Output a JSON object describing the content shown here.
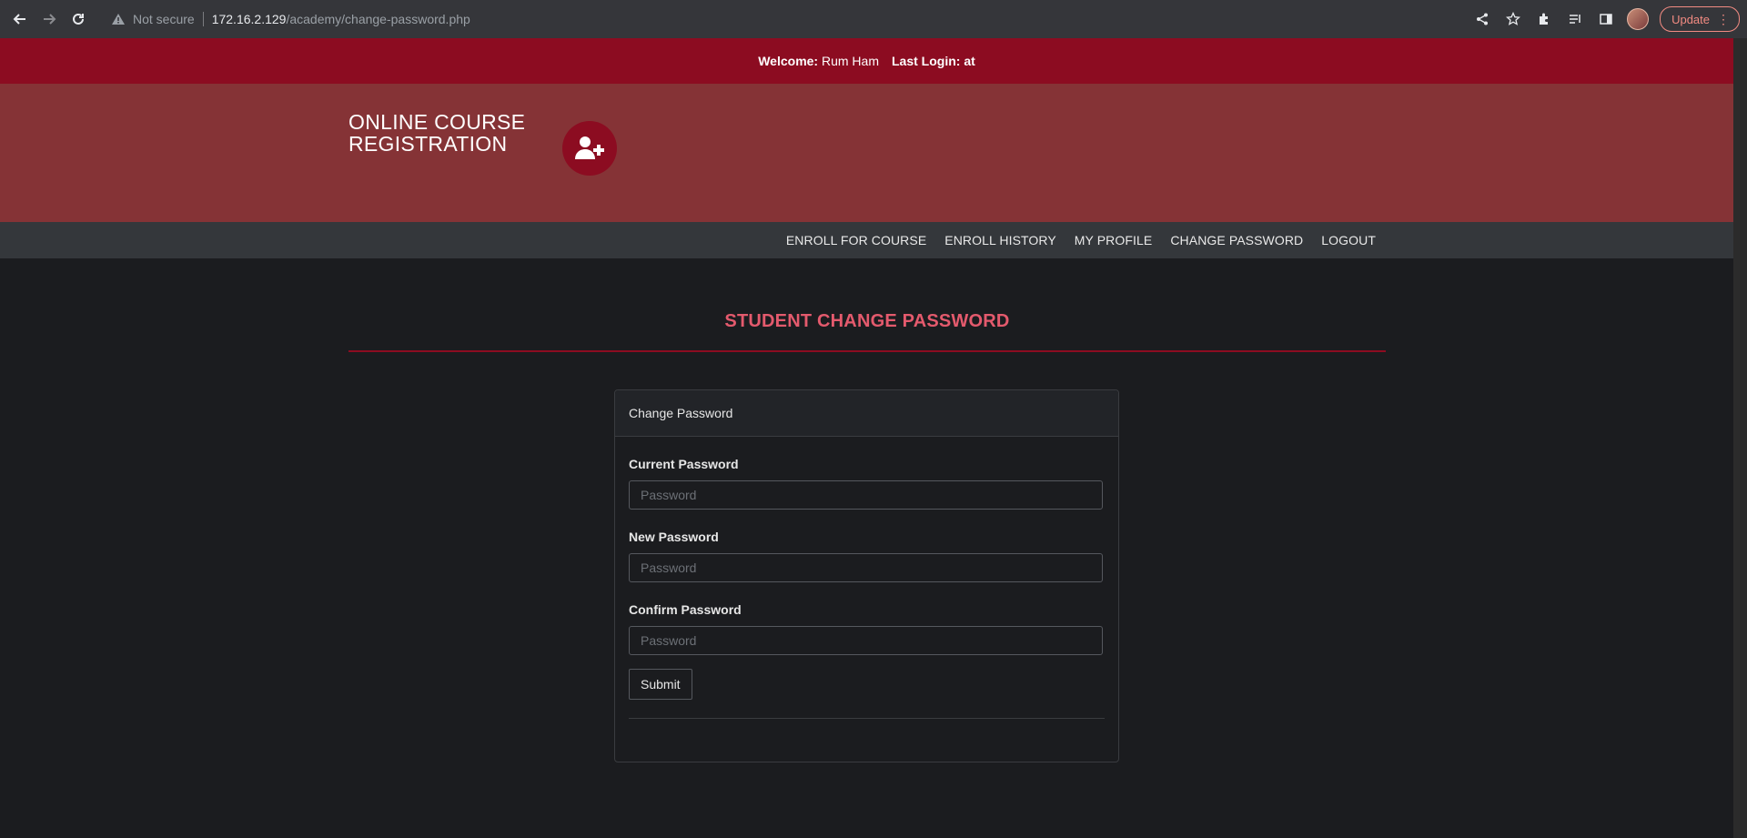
{
  "browser": {
    "security_label": "Not secure",
    "url_host": "172.16.2.129",
    "url_path": "/academy/change-password.php",
    "update_label": "Update"
  },
  "welcome": {
    "welcome_label": "Welcome:",
    "user_name": "Rum Ham",
    "last_login_label": "Last Login: at"
  },
  "header": {
    "title_line1": "ONLINE COURSE",
    "title_line2": "REGISTRATION"
  },
  "menu": {
    "items": [
      {
        "label": "ENROLL FOR COURSE"
      },
      {
        "label": "ENROLL HISTORY"
      },
      {
        "label": "MY PROFILE"
      },
      {
        "label": "CHANGE PASSWORD"
      },
      {
        "label": "LOGOUT"
      }
    ]
  },
  "page": {
    "title": "STUDENT CHANGE PASSWORD"
  },
  "panel": {
    "heading": "Change Password",
    "fields": [
      {
        "label": "Current Password",
        "placeholder": "Password",
        "value": ""
      },
      {
        "label": "New Password",
        "placeholder": "Password",
        "value": ""
      },
      {
        "label": "Confirm Password",
        "placeholder": "Password",
        "value": ""
      }
    ],
    "submit_label": "Submit"
  },
  "colors": {
    "accent": "#8c0c21",
    "header_bg": "#853336",
    "title": "#e45a6d"
  }
}
